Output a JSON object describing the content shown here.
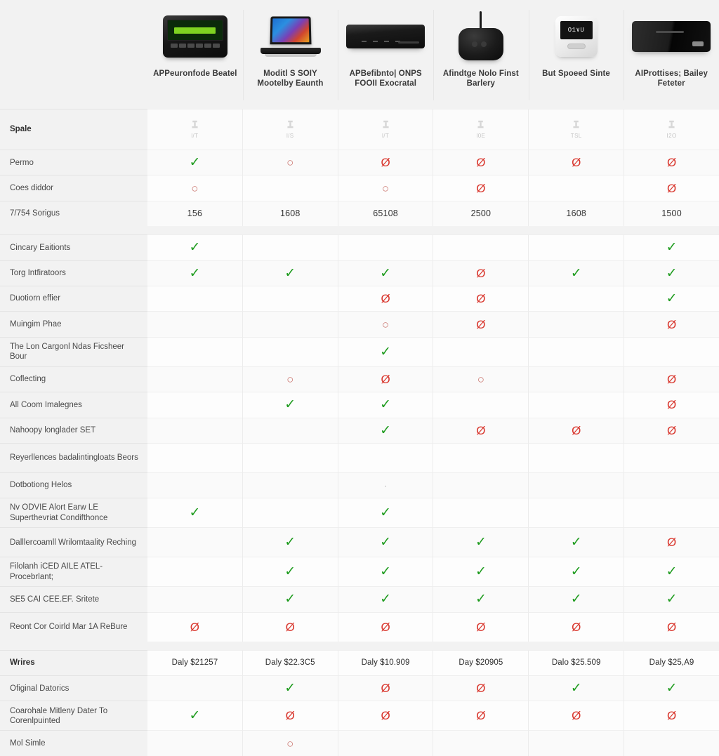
{
  "products": [
    {
      "name": "APPeuronfode Beatel",
      "icon": "hotspot-device-image"
    },
    {
      "name": "Moditl S SOIY Mootelby Eaunth",
      "icon": "laptop-device-image"
    },
    {
      "name": "APBefibnto| ONPS FOOII Exocratal",
      "icon": "settop-box-device-image"
    },
    {
      "name": "Afindtge Nolo Finst Barlery",
      "icon": "antenna-puck-device-image"
    },
    {
      "name": "But Spoeed Sinte",
      "icon": "meter-device-image"
    },
    {
      "name": "AIProttises; Bailey Feteter",
      "icon": "slab-router-device-image"
    }
  ],
  "spec_header": {
    "icon_name": "signal-tower-icon",
    "codes": [
      "l/T",
      "l/S",
      "l/T",
      "l0E",
      "TSL",
      "I2O"
    ]
  },
  "rows": [
    {
      "label": "Spale",
      "bold": true,
      "type": "spec-header",
      "values": [
        "",
        "",
        "",
        "",
        "",
        ""
      ]
    },
    {
      "label": "Permo",
      "type": "mark",
      "values": [
        "yes",
        "part",
        "no",
        "no",
        "no",
        "no"
      ]
    },
    {
      "label": "Coes diddor",
      "type": "mark",
      "values": [
        "part",
        "",
        "part",
        "no",
        "",
        "no"
      ]
    },
    {
      "label": "7/754 Sorigus",
      "type": "value",
      "values": [
        "156",
        "1608",
        "65108",
        "2500",
        "1608",
        "1500"
      ]
    },
    {
      "label": "",
      "type": "gap",
      "values": [
        "",
        "",
        "",
        "",
        "",
        ""
      ]
    },
    {
      "label": "Cincary Eaitionts",
      "type": "mark",
      "values": [
        "yes",
        "",
        "",
        "",
        "",
        "yes"
      ]
    },
    {
      "label": "Torg Intfiratoors",
      "type": "mark",
      "values": [
        "yes",
        "yes",
        "yes",
        "no",
        "yes",
        "yes"
      ]
    },
    {
      "label": "Duotiorn effier",
      "type": "mark",
      "values": [
        "",
        "",
        "no",
        "no",
        "",
        "yes"
      ]
    },
    {
      "label": "Muingim Phae",
      "type": "mark",
      "values": [
        "",
        "",
        "part",
        "no",
        "",
        "no"
      ]
    },
    {
      "label": "The Lon Cargonl Ndas Ficsheer Bour",
      "type": "mark",
      "values": [
        "",
        "",
        "yes",
        "",
        "",
        ""
      ]
    },
    {
      "label": "Coflecting",
      "type": "mark",
      "values": [
        "",
        "part",
        "no",
        "part",
        "",
        "no"
      ]
    },
    {
      "label": "All Coom Imalegnes",
      "type": "mark",
      "values": [
        "",
        "yes",
        "yes",
        "",
        "",
        "no"
      ]
    },
    {
      "label": "Nahoopy longlader SET",
      "type": "mark",
      "values": [
        "",
        "",
        "yes",
        "no",
        "no",
        "no"
      ]
    },
    {
      "label": "Reyerllences badalintingloats Beors",
      "type": "mark",
      "values": [
        "",
        "",
        "",
        "",
        "",
        ""
      ]
    },
    {
      "label": "Dotbotiong Helos",
      "type": "mark",
      "values": [
        "",
        "",
        "dot",
        "",
        "",
        ""
      ]
    },
    {
      "label": "Nv ODVIE Alort Earw LE Superthevriat Condifthonce",
      "type": "mark",
      "values": [
        "yes",
        "",
        "yes",
        "",
        "",
        ""
      ]
    },
    {
      "label": "Dalllercoamll Wrilomtaality Reching",
      "type": "mark",
      "values": [
        "",
        "yes",
        "yes",
        "yes",
        "yes",
        "no"
      ]
    },
    {
      "label": "Filolanh iCED AILE ATEL-Procebrlant;",
      "type": "mark",
      "values": [
        "",
        "yes",
        "yes",
        "yes",
        "yes",
        "yes"
      ]
    },
    {
      "label": "SE5 CAI CEE.EF. Sritete",
      "type": "mark",
      "values": [
        "",
        "yes",
        "yes",
        "yes",
        "yes",
        "yes"
      ]
    },
    {
      "label": "Reont Cor Coirld Mar 1A ReBure",
      "type": "mark",
      "values": [
        "no",
        "no",
        "no",
        "no",
        "no",
        "no"
      ]
    },
    {
      "label": "",
      "type": "gap",
      "values": [
        "",
        "",
        "",
        "",
        "",
        ""
      ]
    },
    {
      "label": "Wrires",
      "bold": true,
      "type": "price",
      "values": [
        "Daly $21257",
        "Daly $22.3C5",
        "Daly $10.909",
        "Day $20905",
        "Dalo $25.509",
        "Daly $25,A9"
      ]
    },
    {
      "label": "Ofiginal Datorics",
      "type": "mark",
      "values": [
        "",
        "yes",
        "no",
        "no",
        "yes",
        "yes"
      ]
    },
    {
      "label": "Coarohale Mitleny Dater To Corenlpuinted",
      "type": "mark",
      "values": [
        "yes",
        "no",
        "no",
        "no",
        "no",
        "no"
      ]
    },
    {
      "label": "Mol Simle",
      "type": "mark",
      "values": [
        "",
        "part",
        "",
        "",
        "",
        ""
      ]
    }
  ],
  "colors": {
    "yes": "#1d9b1d",
    "no": "#d9382f",
    "partial": "#c9726b",
    "page_bg": "#f2f2f2",
    "cell_bg": "#fdfdfd"
  },
  "glyphs": {
    "yes": "✓",
    "no": "Ø",
    "part": "○",
    "dot": "·"
  }
}
